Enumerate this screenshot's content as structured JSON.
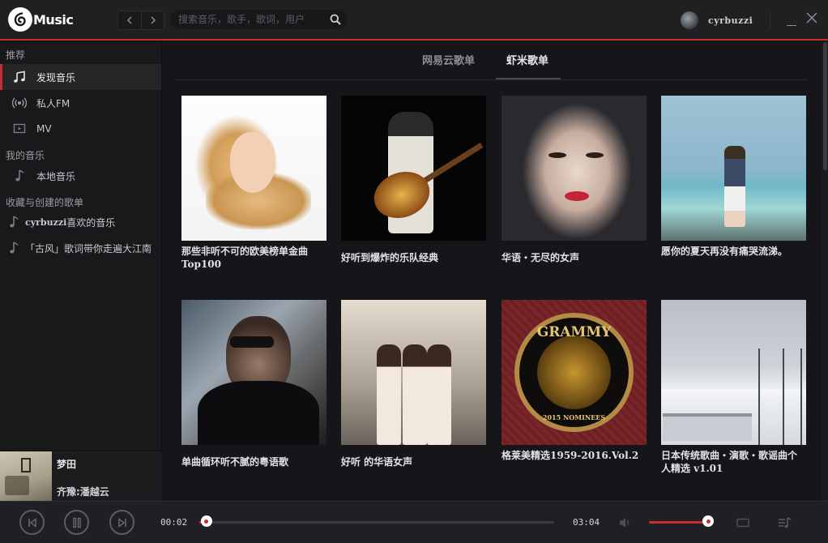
{
  "app": {
    "logo_text": "Music"
  },
  "header": {
    "search_placeholder": "搜索音乐，歌手，歌词，用户",
    "username": "cyrbuzzi"
  },
  "sidebar": {
    "sections": [
      {
        "title": "推荐"
      },
      {
        "title": "我的音乐"
      },
      {
        "title": "收藏与创建的歌单"
      }
    ],
    "recommend": [
      {
        "label": "发现音乐",
        "icon": "music-note-icon",
        "active": true
      },
      {
        "label": "私人FM",
        "icon": "radio-icon",
        "active": false
      },
      {
        "label": "MV",
        "icon": "tv-icon",
        "active": false
      }
    ],
    "my_music": [
      {
        "label": "本地音乐",
        "icon": "music-note-icon"
      }
    ],
    "playlists": [
      {
        "prefix": "cyrbuzzi",
        "suffix": "喜欢的音乐",
        "icon": "music-note-icon"
      },
      {
        "label": "「古风」歌词带你走遍大江南",
        "icon": "music-note-icon"
      }
    ]
  },
  "now_playing": {
    "title": "梦田",
    "artist": "齐豫:潘越云"
  },
  "tabs": [
    {
      "label": "网易云歌单",
      "active": false
    },
    {
      "label": "虾米歌单",
      "active": true
    }
  ],
  "playlists_grid": [
    {
      "title": "那些非听不可的欧美榜单金曲Top100"
    },
    {
      "title": "好听到爆炸的乐队经典"
    },
    {
      "title": "华语・无尽的女声"
    },
    {
      "title": "愿你的夏天再没有痛哭流涕。"
    },
    {
      "title": "单曲循环听不腻的粤语歌"
    },
    {
      "title": "好听 的华语女声"
    },
    {
      "title": "格莱美精选1959-2016.Vol.2"
    },
    {
      "title": "日本传统歌曲・演歌・歌谣曲个人精选 v1.01"
    }
  ],
  "cover_text": {
    "grammy_top": "GRAMMY",
    "grammy_bottom": "2015 NOMINEES"
  },
  "player": {
    "current_time": "00:02",
    "total_time": "03:04",
    "progress": 0.011,
    "volume": 1.0
  },
  "colors": {
    "accent": "#c62f2f",
    "background": "#16161a"
  }
}
